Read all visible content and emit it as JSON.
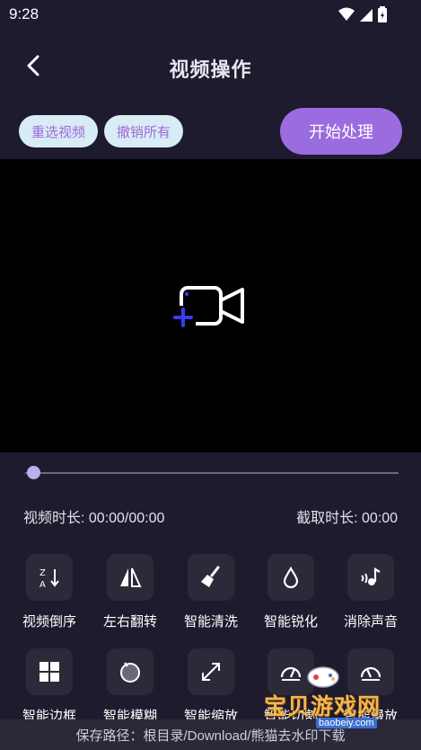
{
  "status_bar": {
    "time": "9:28"
  },
  "header": {
    "title": "视频操作"
  },
  "actions": {
    "reselect_label": "重选视频",
    "undo_all_label": "撤销所有",
    "start_label": "开始处理"
  },
  "player": {
    "progress": 0
  },
  "durations": {
    "video_duration": "视频时长: 00:00/00:00",
    "clip_duration": "截取时长: 00:00"
  },
  "tools": [
    {
      "label": "视频倒序",
      "icon": "sort-reverse-icon"
    },
    {
      "label": "左右翻转",
      "icon": "flip-horizontal-icon"
    },
    {
      "label": "智能清洗",
      "icon": "broom-icon"
    },
    {
      "label": "智能锐化",
      "icon": "drop-icon"
    },
    {
      "label": "消除声音",
      "icon": "mute-note-icon"
    },
    {
      "label": "智能边框",
      "icon": "frame-icon"
    },
    {
      "label": "智能模糊",
      "icon": "blur-icon"
    },
    {
      "label": "智能缩放",
      "icon": "scale-icon"
    },
    {
      "label": "智能切割",
      "icon": "speed-gauge-icon"
    },
    {
      "label": "智能慢放",
      "icon": "slow-gauge-icon"
    }
  ],
  "footer": {
    "save_path": "保存路径：根目录/Download/熊猫去水印下载"
  },
  "watermark": {
    "brand": "宝贝游戏网",
    "url": "baobeiy.com"
  },
  "colors": {
    "accent": "#9b6be0",
    "pill_bg": "#d8ecf5",
    "pill_text": "#a06ad8",
    "background": "#1e1b2e",
    "add_icon_plus": "#3b3bf0"
  }
}
